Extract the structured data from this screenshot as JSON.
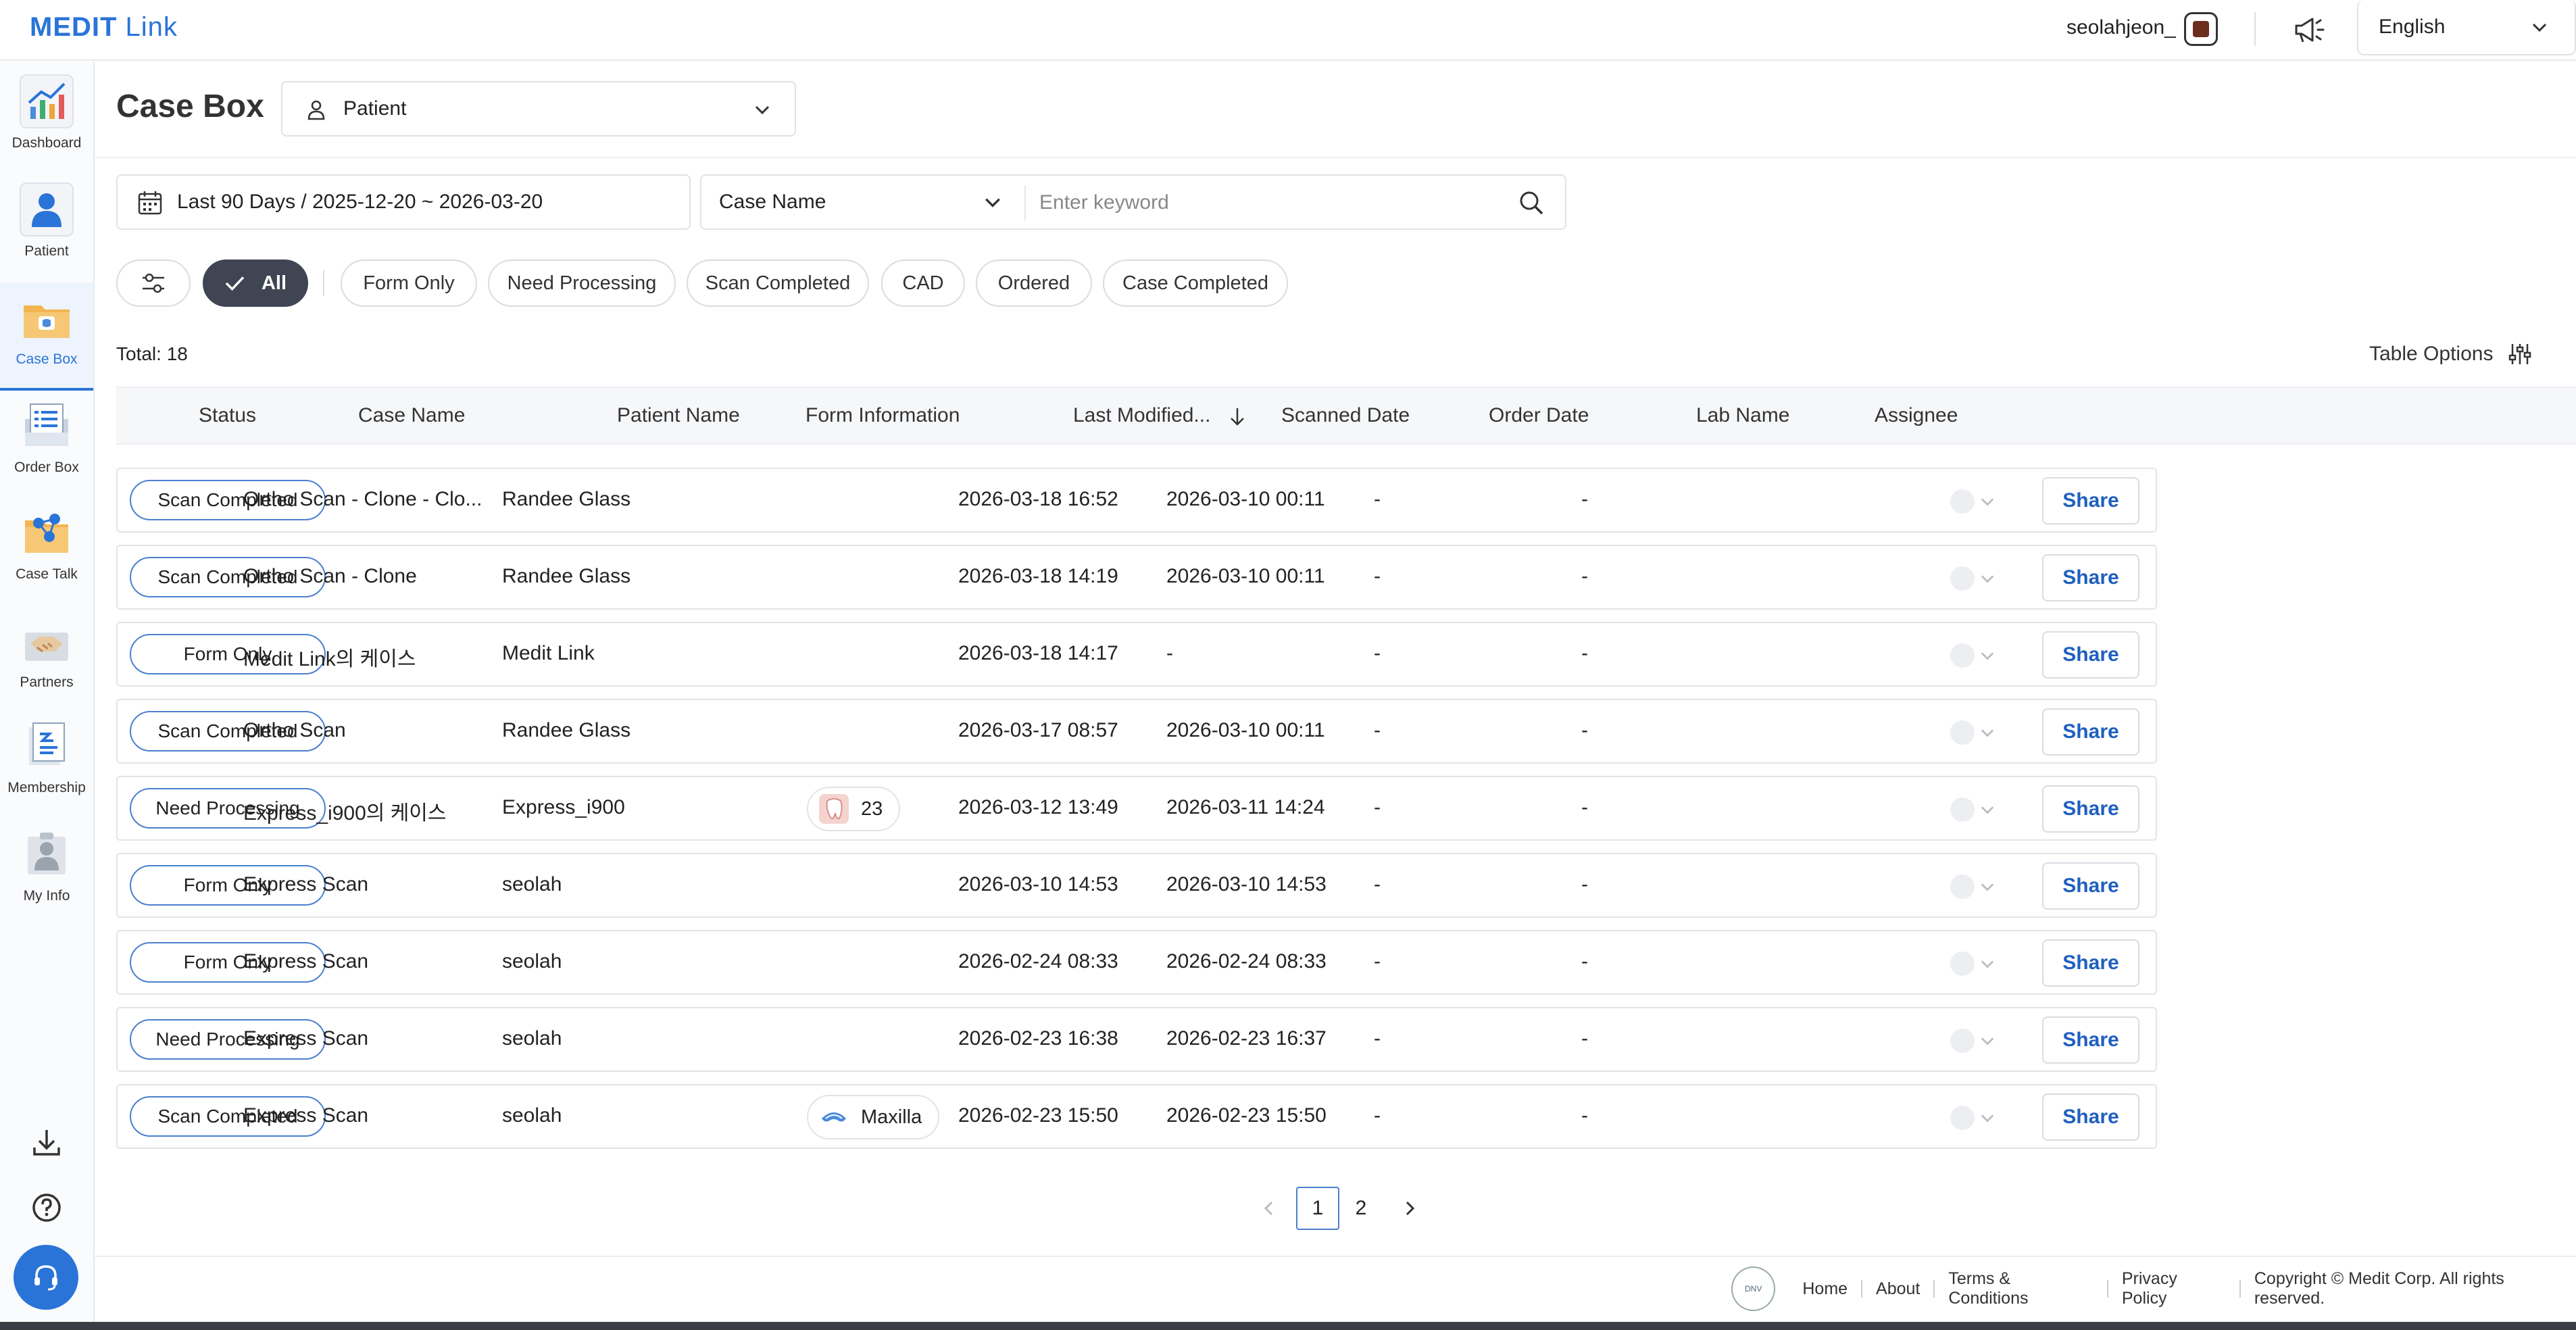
{
  "app": {
    "logo_bold": "MEDIT",
    "logo_rest": " Link"
  },
  "topbar": {
    "username": "seolahjeon_",
    "language": "English",
    "icons": [
      "user-badge-icon",
      "megaphone-icon",
      "chevron-down-icon"
    ]
  },
  "sidebar": {
    "items": [
      {
        "label": "Dashboard",
        "icon": "dashboard-chart-icon"
      },
      {
        "label": "Patient",
        "icon": "patient-icon"
      },
      {
        "label": "Case Box",
        "icon": "case-box-icon",
        "active": true
      },
      {
        "label": "Order Box",
        "icon": "order-box-icon"
      },
      {
        "label": "Case Talk",
        "icon": "case-talk-icon"
      },
      {
        "label": "Partners",
        "icon": "partners-icon"
      },
      {
        "label": "Membership",
        "icon": "membership-icon"
      },
      {
        "label": "My Info",
        "icon": "my-info-icon"
      }
    ],
    "bottom_icons": [
      "download-icon",
      "help-icon",
      "support-headset-icon"
    ]
  },
  "header": {
    "title": "Case Box",
    "type_select": "Patient"
  },
  "filters": {
    "date_range": "Last 90 Days / 2025-12-20 ~ 2026-03-20",
    "search_field": "Case Name",
    "search_placeholder": "Enter keyword",
    "search_value": "",
    "chips": [
      "All",
      "Form Only",
      "Need Processing",
      "Scan Completed",
      "CAD",
      "Ordered",
      "Case Completed"
    ],
    "selected_chip": "All"
  },
  "summary": {
    "total": "Total: 18",
    "table_options": "Table Options"
  },
  "table": {
    "columns": [
      "Status",
      "Case Name",
      "Patient Name",
      "Form Information",
      "Last Modified...",
      "Scanned Date",
      "Order Date",
      "Lab Name",
      "Assignee"
    ],
    "sort_column": "Last Modified...",
    "sort_direction": "descending",
    "share_label": "Share",
    "rows": [
      {
        "status": "Scan Completed",
        "case_name": "Ortho Scan - Clone - Clo...",
        "patient": "Randee Glass",
        "form": "",
        "form_icon": "",
        "modified": "2026-03-18 16:52",
        "scanned": "2026-03-10 00:11",
        "order_date": "-",
        "lab": "-"
      },
      {
        "status": "Scan Completed",
        "case_name": "Ortho Scan - Clone",
        "patient": "Randee Glass",
        "form": "",
        "form_icon": "",
        "modified": "2026-03-18 14:19",
        "scanned": "2026-03-10 00:11",
        "order_date": "-",
        "lab": "-"
      },
      {
        "status": "Form Only",
        "case_name": "Medit Link의 케이스",
        "patient": "Medit Link",
        "form": "",
        "form_icon": "",
        "modified": "2026-03-18 14:17",
        "scanned": "-",
        "order_date": "-",
        "lab": "-"
      },
      {
        "status": "Scan Completed",
        "case_name": "Ortho Scan",
        "patient": "Randee Glass",
        "form": "",
        "form_icon": "",
        "modified": "2026-03-17 08:57",
        "scanned": "2026-03-10 00:11",
        "order_date": "-",
        "lab": "-"
      },
      {
        "status": "Need Processing",
        "case_name": "Express_i900의 케이스",
        "patient": "Express_i900",
        "form": "23",
        "form_icon": "tooth-icon",
        "modified": "2026-03-12 13:49",
        "scanned": "2026-03-11 14:24",
        "order_date": "-",
        "lab": "-"
      },
      {
        "status": "Form Only",
        "case_name": "Express Scan",
        "patient": "seolah",
        "form": "",
        "form_icon": "",
        "modified": "2026-03-10 14:53",
        "scanned": "2026-03-10 14:53",
        "order_date": "-",
        "lab": "-"
      },
      {
        "status": "Form Only",
        "case_name": "Express Scan",
        "patient": "seolah",
        "form": "",
        "form_icon": "",
        "modified": "2026-02-24 08:33",
        "scanned": "2026-02-24 08:33",
        "order_date": "-",
        "lab": "-"
      },
      {
        "status": "Need Processing",
        "case_name": "Express Scan",
        "patient": "seolah",
        "form": "",
        "form_icon": "",
        "modified": "2026-02-23 16:38",
        "scanned": "2026-02-23 16:37",
        "order_date": "-",
        "lab": "-"
      },
      {
        "status": "Scan Completed",
        "case_name": "Express Scan",
        "patient": "seolah",
        "form": "Maxilla",
        "form_icon": "maxilla-icon",
        "modified": "2026-02-23 15:50",
        "scanned": "2026-02-23 15:50",
        "order_date": "-",
        "lab": "-"
      }
    ]
  },
  "pagination": {
    "pages": [
      "1",
      "2"
    ],
    "current": "1"
  },
  "footer": {
    "badge_text": "DNV",
    "links": [
      "Home",
      "About",
      "Terms & Conditions",
      "Privacy Policy"
    ],
    "copyright": "Copyright © Medit Corp. All rights reserved."
  },
  "colors": {
    "brand": "#2a74d8",
    "active_chip": "#3f4552",
    "share_text": "#1f5fbf",
    "status_border": "#4b7fd0"
  }
}
